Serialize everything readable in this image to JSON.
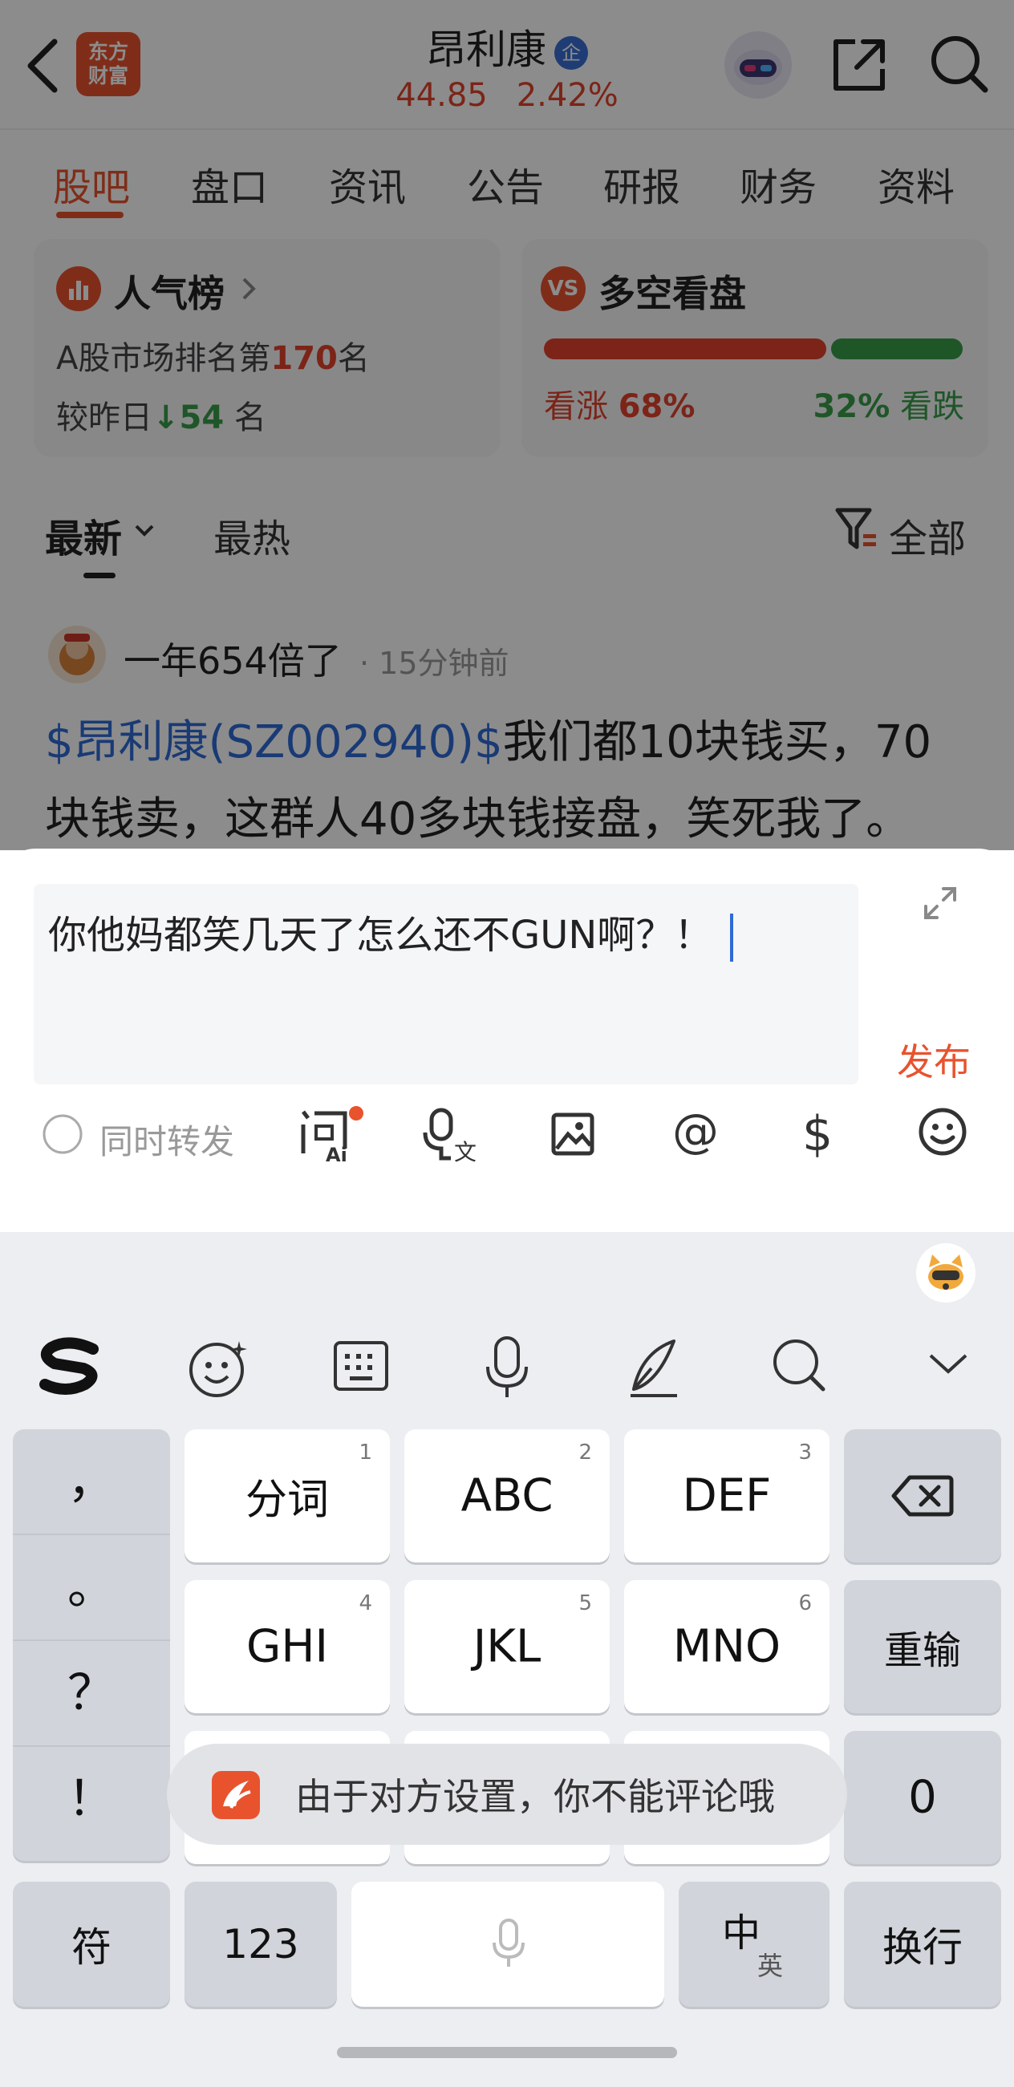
{
  "header": {
    "logo_line1": "东方",
    "logo_line2": "财富",
    "stock_name": "昂利康",
    "badge": "企",
    "price": "44.85",
    "change": "2.42%"
  },
  "tabs": [
    "股吧",
    "盘口",
    "资讯",
    "公告",
    "研报",
    "财务",
    "资料"
  ],
  "popularity": {
    "title": "人气榜",
    "rank_prefix": "A股市场排名第",
    "rank": "170",
    "rank_suffix": "名",
    "change_prefix": "较昨日",
    "change_value": "54",
    "change_suffix": "名"
  },
  "sentiment": {
    "icon": "VS",
    "title": "多空看盘",
    "bull_label": "看涨",
    "bull_pct": "68%",
    "bear_pct": "32%",
    "bear_label": "看跌",
    "bull_ratio": 0.68
  },
  "sort": {
    "latest": "最新",
    "hottest": "最热",
    "filter": "全部"
  },
  "post": {
    "author": "一年654倍了",
    "time": "· 15分钟前",
    "tag": "$昂利康(SZ002940)$",
    "text": "我们都10块钱买，70块钱卖，这群人40多块钱接盘，笑死我了。"
  },
  "composer": {
    "text": "你他妈都笑几天了怎么还不GUN啊？！",
    "publish": "发布",
    "repost_label": "同时转发"
  },
  "keyboard": {
    "punct": [
      "，",
      "。",
      "？",
      "！"
    ],
    "row1": [
      {
        "label": "分词",
        "num": "1"
      },
      {
        "label": "ABC",
        "num": "2"
      },
      {
        "label": "DEF",
        "num": "3"
      }
    ],
    "row2": [
      {
        "label": "GHI",
        "num": "4"
      },
      {
        "label": "JKL",
        "num": "5"
      },
      {
        "label": "MNO",
        "num": "6"
      }
    ],
    "retype": "重输",
    "zero": "0",
    "symbols": "符",
    "numbers": "123",
    "lang_main": "中",
    "lang_sub": "英",
    "enter": "换行"
  },
  "toast": {
    "text": "由于对方设置，你不能评论哦"
  },
  "colors": {
    "brand": "#e8532e",
    "up": "#e2432c",
    "down": "#3a9d4a",
    "link": "#2f6bd6"
  }
}
